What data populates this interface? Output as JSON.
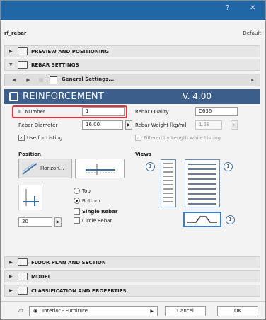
{
  "titlebar": {
    "help_glyph": "?",
    "close_glyph": "✕",
    "color": "#2166a5"
  },
  "panel": {
    "name": "rf_rebar",
    "default_label": "Default"
  },
  "sections": {
    "preview": "PREVIEW AND POSITIONING",
    "rebar_settings": "REBAR SETTINGS",
    "floor_plan": "FLOOR PLAN AND SECTION",
    "model": "MODEL",
    "classification": "CLASSIFICATION AND PROPERTIES"
  },
  "nav": {
    "page_label": "General Settings..."
  },
  "header": {
    "title": "REINFORCEMENT",
    "version": "V. 4.00"
  },
  "fields": {
    "id_number_label": "ID Number",
    "id_number_value": "1",
    "rebar_diameter_label": "Rebar Diameter",
    "rebar_diameter_value": "16.00",
    "use_for_listing_label": "Use for Listing",
    "use_for_listing_checked": true,
    "rebar_quality_label": "Rebar Quality",
    "rebar_quality_value": "C636",
    "rebar_weight_label": "Rebar Weight [kg/m]",
    "rebar_weight_value": "1.58",
    "filtered_label": "Filtered by Length while Listing"
  },
  "position": {
    "title": "Position",
    "dropdown_label": "Horizon...",
    "top_label": "Top",
    "bottom_label": "Bottom",
    "selected": "Bottom",
    "single_rebar_label": "Single Rebar",
    "circle_rebar_label": "Circle Rebar",
    "amount_value": "20"
  },
  "views": {
    "title": "Views",
    "badges": [
      "1",
      "1",
      "1"
    ]
  },
  "footer": {
    "layer_label": "Interior - Furniture",
    "cancel_label": "Cancel",
    "ok_label": "OK"
  }
}
